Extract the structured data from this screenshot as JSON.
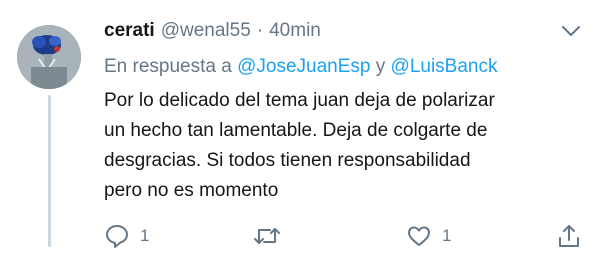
{
  "tweet": {
    "display_name": "cerati",
    "handle": "@wenal55",
    "separator": "·",
    "time": "40min",
    "reply_prefix": "En respuesta a",
    "mention_1": "@JoseJuanEsp",
    "reply_join": "y",
    "mention_2": "@LuisBanck",
    "text_lines": [
      "Por lo delicado del tema juan deja de polarizar",
      "un hecho tan lamentable. Deja de colgarte de",
      "desgracias. Si todos tienen responsabilidad",
      "pero no es momento"
    ]
  },
  "actions": {
    "reply_count": "1",
    "like_count": "1"
  },
  "icons": {
    "menu": "chevron-down-icon",
    "reply": "reply-icon",
    "retweet": "retweet-icon",
    "like": "heart-icon",
    "share": "share-icon"
  },
  "colors": {
    "text": "#14171a",
    "secondary": "#657786",
    "mention": "#1da1f2",
    "thread_line": "#ccd6dd"
  }
}
